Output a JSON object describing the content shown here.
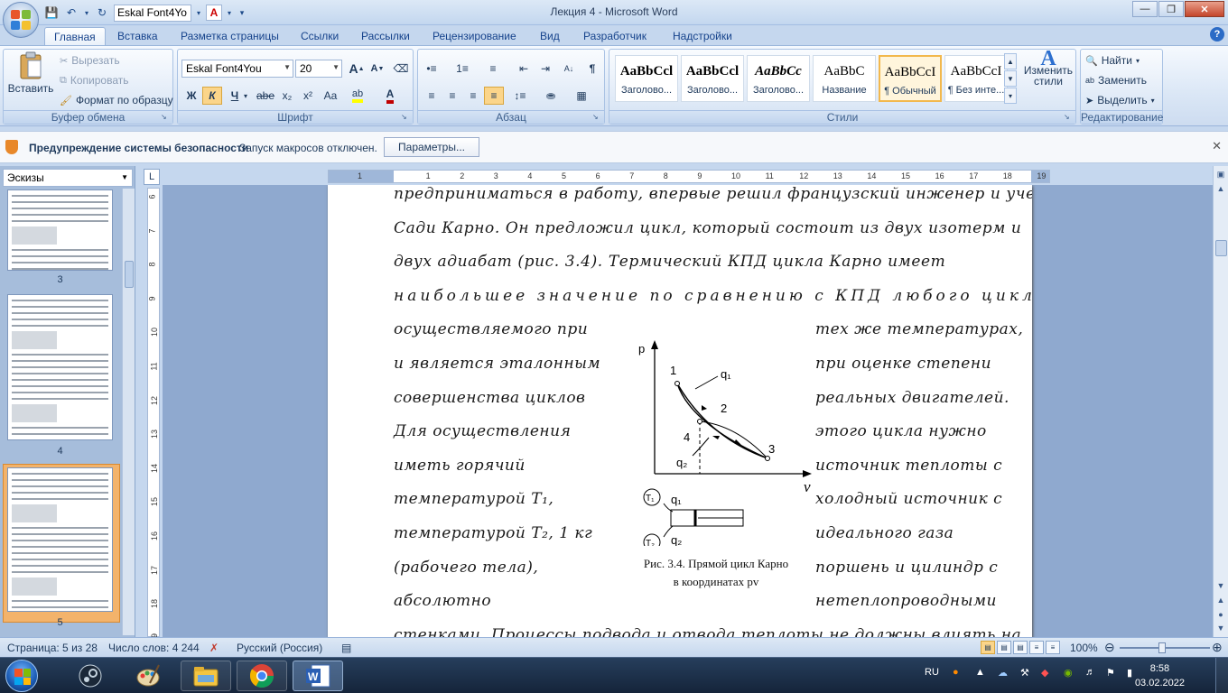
{
  "window": {
    "title": "Лекция 4  -  Microsoft Word",
    "qat_font": "Eskal Font4Yo"
  },
  "tabs": [
    "Главная",
    "Вставка",
    "Разметка страницы",
    "Ссылки",
    "Рассылки",
    "Рецензирование",
    "Вид",
    "Разработчик",
    "Надстройки"
  ],
  "ribbon": {
    "clipboard": {
      "label": "Буфер обмена",
      "paste": "Вставить",
      "cut": "Вырезать",
      "copy": "Копировать",
      "format_painter": "Формат по образцу"
    },
    "font": {
      "label": "Шрифт",
      "font_name": "Eskal Font4You",
      "font_size": "20",
      "bold": "Ж",
      "italic": "К",
      "underline": "Ч",
      "strike": "abe",
      "subscript": "x₂",
      "superscript": "x²",
      "change_case": "Aa",
      "grow": "A",
      "shrink": "A"
    },
    "paragraph": {
      "label": "Абзац"
    },
    "styles": {
      "label": "Стили",
      "items": [
        {
          "sample": "AaBbCcl",
          "name": "Заголово...",
          "bold": true,
          "italic": false
        },
        {
          "sample": "AaBbCcl",
          "name": "Заголово...",
          "bold": true,
          "italic": false
        },
        {
          "sample": "AaBbCc",
          "name": "Заголово...",
          "bold": true,
          "italic": true
        },
        {
          "sample": "AaBbC",
          "name": "Название",
          "bold": false,
          "italic": false
        },
        {
          "sample": "AaBbCcI",
          "name": "¶ Обычный",
          "bold": false,
          "italic": false
        },
        {
          "sample": "AaBbCcI",
          "name": "¶ Без инте...",
          "bold": false,
          "italic": false
        }
      ],
      "change_styles": "Изменить стили"
    },
    "editing": {
      "label": "Редактирование",
      "find": "Найти",
      "replace": "Заменить",
      "select": "Выделить"
    }
  },
  "security": {
    "title": "Предупреждение системы безопасности",
    "message": "Запуск макросов отключен.",
    "button": "Параметры..."
  },
  "thumbnails": {
    "view": "Эскизы",
    "pages": [
      "3",
      "4",
      "5"
    ]
  },
  "ruler": {
    "h_marks": [
      "1",
      "1",
      "2",
      "3",
      "4",
      "5",
      "6",
      "7",
      "8",
      "9",
      "10",
      "11",
      "12",
      "13",
      "14",
      "15",
      "16",
      "17",
      "18",
      "19"
    ],
    "v_marks": [
      "6",
      "7",
      "8",
      "9",
      "10",
      "11",
      "12",
      "13",
      "14",
      "15",
      "16",
      "17",
      "18",
      "19"
    ]
  },
  "document": {
    "lines_left": [
      "предприниматься в работу, впервые решил французский инженер и ученый",
      "Сади Карно. Он предложил цикл, который состоит из двух изотерм и",
      "двух адиабат (рис. 3.4). Термический КПД цикла Карно имеет",
      "наибольшее значение по сравнению с КПД любого цикла,",
      "осуществляемого при",
      "и является эталонным",
      "совершенства циклов",
      "Для осуществления",
      "иметь горячий",
      "температурой T₁,",
      "температурой T₂, 1 кг",
      "(рабочего тела),",
      "абсолютно"
    ],
    "lines_right": [
      "тех же температурах,",
      "при оценке степени",
      "реальных двигателей.",
      "этого цикла нужно",
      "источник теплоты с",
      "холодный источник с",
      "идеального газа",
      "поршень и цилиндр с",
      "нетеплопроводными"
    ],
    "last_line": "стенками. Процессы подвода и отвода теплоты не должны влиять на",
    "figure": {
      "caption_line1": "Рис. 3.4. Прямой цикл Карно",
      "caption_line2": "в координатах pv",
      "axis_p": "p",
      "axis_v": "v",
      "pt1": "1",
      "pt2": "2",
      "pt3": "3",
      "pt4": "4",
      "q1": "q₁",
      "q2": "q₂",
      "t1": "T₁",
      "t2": "T₂"
    }
  },
  "status": {
    "page": "Страница: 5 из 28",
    "words": "Число слов: 4 244",
    "language": "Русский (Россия)",
    "zoom": "100%"
  },
  "taskbar": {
    "lang": "RU",
    "time": "8:58",
    "date": "03.02.2022"
  },
  "colors": {
    "accent": "#15428b",
    "ribbon_bg": "#dbe7f6",
    "selected_style": "#f2b84d",
    "thumb_selected": "#f3b36b"
  }
}
